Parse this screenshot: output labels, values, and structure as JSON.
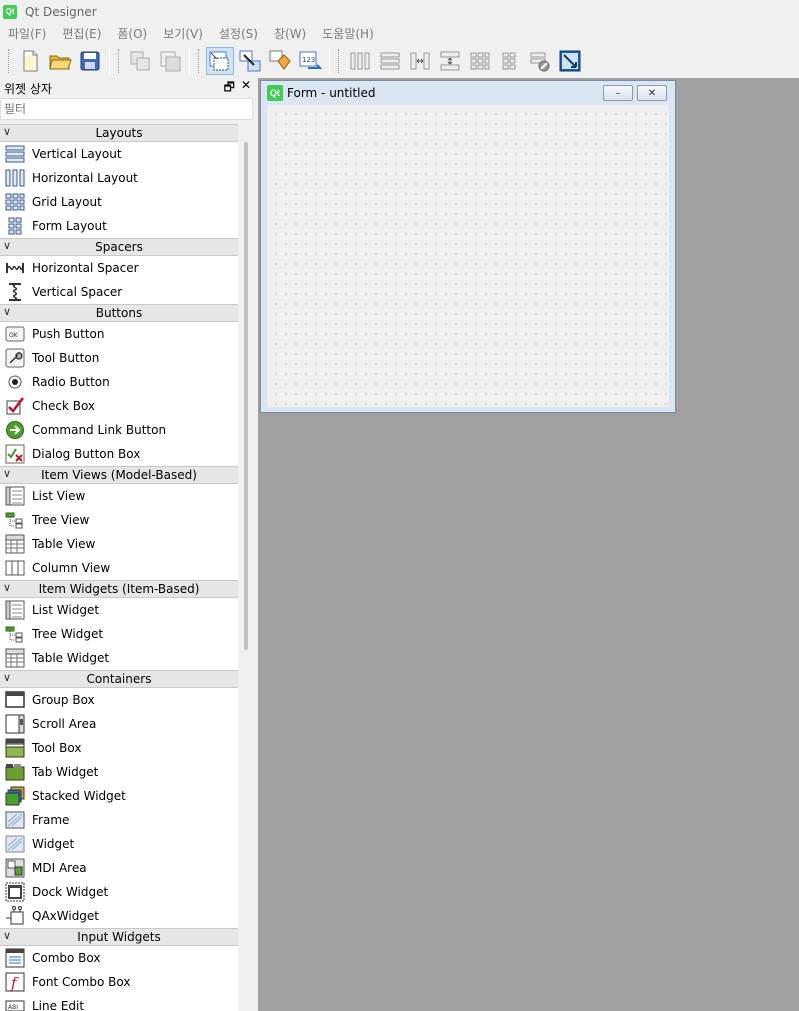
{
  "app": {
    "title": "Qt Designer",
    "logo": "Qt"
  },
  "menu": [
    "파일(F)",
    "편집(E)",
    "폼(O)",
    "보기(V)",
    "설정(S)",
    "창(W)",
    "도움말(H)"
  ],
  "dock": {
    "title": "위젯 상자",
    "filter_placeholder": "필터",
    "categories": [
      {
        "label": "Layouts",
        "items": [
          {
            "label": "Vertical Layout",
            "icon": "vertical-layout-icon"
          },
          {
            "label": "Horizontal Layout",
            "icon": "horizontal-layout-icon"
          },
          {
            "label": "Grid Layout",
            "icon": "grid-layout-icon"
          },
          {
            "label": "Form Layout",
            "icon": "form-layout-icon"
          }
        ]
      },
      {
        "label": "Spacers",
        "items": [
          {
            "label": "Horizontal Spacer",
            "icon": "horizontal-spacer-icon"
          },
          {
            "label": "Vertical Spacer",
            "icon": "vertical-spacer-icon"
          }
        ]
      },
      {
        "label": "Buttons",
        "items": [
          {
            "label": "Push Button",
            "icon": "push-button-icon"
          },
          {
            "label": "Tool Button",
            "icon": "tool-button-icon"
          },
          {
            "label": "Radio Button",
            "icon": "radio-button-icon"
          },
          {
            "label": "Check Box",
            "icon": "check-box-icon"
          },
          {
            "label": "Command Link Button",
            "icon": "command-link-icon"
          },
          {
            "label": "Dialog Button Box",
            "icon": "dialog-button-box-icon"
          }
        ]
      },
      {
        "label": "Item Views (Model-Based)",
        "items": [
          {
            "label": "List View",
            "icon": "list-view-icon"
          },
          {
            "label": "Tree View",
            "icon": "tree-view-icon"
          },
          {
            "label": "Table View",
            "icon": "table-view-icon"
          },
          {
            "label": "Column View",
            "icon": "column-view-icon"
          }
        ]
      },
      {
        "label": "Item Widgets (Item-Based)",
        "items": [
          {
            "label": "List Widget",
            "icon": "list-widget-icon"
          },
          {
            "label": "Tree Widget",
            "icon": "tree-widget-icon"
          },
          {
            "label": "Table Widget",
            "icon": "table-widget-icon"
          }
        ]
      },
      {
        "label": "Containers",
        "items": [
          {
            "label": "Group Box",
            "icon": "group-box-icon"
          },
          {
            "label": "Scroll Area",
            "icon": "scroll-area-icon"
          },
          {
            "label": "Tool Box",
            "icon": "tool-box-icon"
          },
          {
            "label": "Tab Widget",
            "icon": "tab-widget-icon"
          },
          {
            "label": "Stacked Widget",
            "icon": "stacked-widget-icon"
          },
          {
            "label": "Frame",
            "icon": "frame-icon"
          },
          {
            "label": "Widget",
            "icon": "widget-icon"
          },
          {
            "label": "MDI Area",
            "icon": "mdi-area-icon"
          },
          {
            "label": "Dock Widget",
            "icon": "dock-widget-icon"
          },
          {
            "label": "QAxWidget",
            "icon": "qaxwidget-icon"
          }
        ]
      },
      {
        "label": "Input Widgets",
        "items": [
          {
            "label": "Combo Box",
            "icon": "combo-box-icon"
          },
          {
            "label": "Font Combo Box",
            "icon": "font-combo-box-icon"
          },
          {
            "label": "Line Edit",
            "icon": "line-edit-icon"
          }
        ]
      }
    ]
  },
  "form": {
    "title": "Form - untitled",
    "logo": "Qt"
  },
  "colors": {
    "qt_green": "#41cd52",
    "mdi_bg": "#a0a0a0",
    "accent": "#2a6cc4"
  }
}
